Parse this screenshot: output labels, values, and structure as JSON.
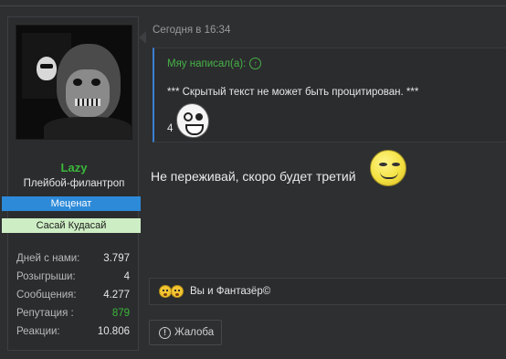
{
  "user": {
    "name": "Lazy",
    "title": "Плейбой-филантроп",
    "banners": [
      "Меценат",
      "Сасай Кудасай"
    ],
    "stats": [
      {
        "label": "Дней с нами:",
        "value": "3.797"
      },
      {
        "label": "Розыгрыши:",
        "value": "4"
      },
      {
        "label": "Сообщения:",
        "value": "4.277"
      },
      {
        "label": "Репутация :",
        "value": "879"
      },
      {
        "label": "Реакции:",
        "value": "10.806"
      }
    ]
  },
  "post": {
    "date": "Сегодня в 16:34",
    "quote": {
      "author": "Мяу написал(а):",
      "text": "*** Скрытый текст не может быть процитирован. ***",
      "number": "4"
    },
    "body": "Не переживай, скоро будет третий",
    "reactions_text": "Вы и Фантазёр©",
    "report_label": "Жалоба"
  },
  "colors": {
    "username": "#3bb73b",
    "banner_blue": "#2d8ad9",
    "banner_green": "#cdeec4",
    "quote_border": "#3b7fd1",
    "reputation": "#3bb73b"
  },
  "icons": [
    "avatar-image",
    "arrow-up-circle-icon",
    "rage-face-icon",
    "troll-face-icon",
    "reaction-emoji-icon",
    "alert-circle-icon"
  ]
}
